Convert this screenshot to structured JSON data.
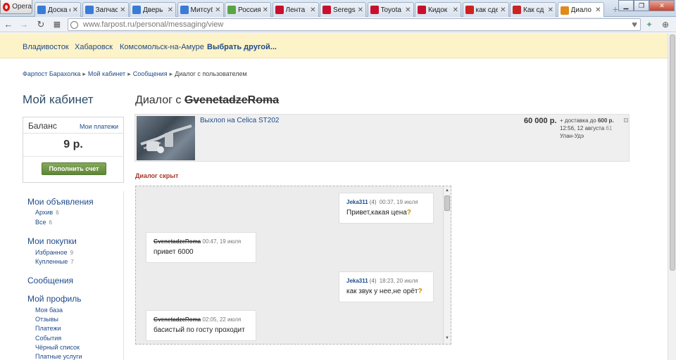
{
  "browser": {
    "menu_label": "Opera",
    "tabs": [
      {
        "label": "Доска о",
        "color": "#3a7bd5"
      },
      {
        "label": "Запчас",
        "color": "#3a7bd5"
      },
      {
        "label": "Дверь",
        "color": "#3a7bd5"
      },
      {
        "label": "Митсуб",
        "color": "#3a7bd5"
      },
      {
        "label": "Россия",
        "color": "#5aa445"
      },
      {
        "label": "Лента",
        "color": "#c8102e"
      },
      {
        "label": "Seregs",
        "color": "#c8102e"
      },
      {
        "label": "Toyota",
        "color": "#c8102e"
      },
      {
        "label": "Кидок",
        "color": "#c8102e"
      },
      {
        "label": "как сде",
        "color": "#cc2222"
      },
      {
        "label": "Как сд",
        "color": "#cc2222"
      },
      {
        "label": "Диало",
        "color": "#e08a1e",
        "active": true
      }
    ],
    "url_host": "www.farpost.ru",
    "url_path": "/personal/messaging/view"
  },
  "cities": {
    "vladivostok": "Владивосток",
    "khabarovsk": "Хабаровск",
    "komsomolsk": "Комсомольск-на-Амуре",
    "choose_other": "Выбрать другой..."
  },
  "breadcrumb": {
    "item1": "Фарпост Барахолка",
    "item2": "Мой кабинет",
    "item3": "Сообщения",
    "current": "Диалог с пользователем",
    "separator": "▸"
  },
  "sidebar": {
    "title": "Мой кабинет",
    "balance_label": "Баланс",
    "payments_link": "Мои платежи",
    "balance_amount": "9 р.",
    "topup_button": "Пополнить счет",
    "my_ads": "Мои объявления",
    "archive": "Архив",
    "archive_count": "6",
    "all": "Все",
    "all_count": "6",
    "my_purchases": "Мои покупки",
    "favorites": "Избранное",
    "favorites_count": "9",
    "bought": "Купленные",
    "bought_count": "7",
    "messages": "Сообщения",
    "my_profile": "Мой профиль",
    "my_base": "Моя база",
    "reviews": "Отзывы",
    "payments": "Платежи",
    "events": "События",
    "blacklist": "Чёрный список",
    "paid_services": "Платные услуги"
  },
  "dialog": {
    "title_prefix": "Диалог с",
    "partner": "GvenetadzeRoma",
    "hidden_notice": "Диалог скрыт"
  },
  "ad": {
    "title": "Выхлоп на Celica ST202",
    "price": "60 000 р.",
    "delivery_prefix": "+ доставка до",
    "delivery_amount": "600 р.",
    "posted": "12:56, 12 августа",
    "city": "Улан-Удэ",
    "views": "61"
  },
  "messages": [
    {
      "author": "Jeka311",
      "rating": "(4)",
      "time": "00:37, 19 июля",
      "text": "Привет,какая цена",
      "q": "?",
      "side": "right"
    },
    {
      "author": "GvenetadzeRoma",
      "rating": "",
      "time": "00:47, 19 июля",
      "text": "привет 6000",
      "q": "",
      "side": "left"
    },
    {
      "author": "Jeka311",
      "rating": "(4)",
      "time": "18:23, 20 июля",
      "text": "как звук у нее,не орёт",
      "q": "?",
      "side": "right"
    },
    {
      "author": "GvenetadzeRoma",
      "rating": "",
      "time": "02:05, 22 июля",
      "text": "басистый по госту проходит",
      "q": "",
      "side": "left"
    }
  ]
}
